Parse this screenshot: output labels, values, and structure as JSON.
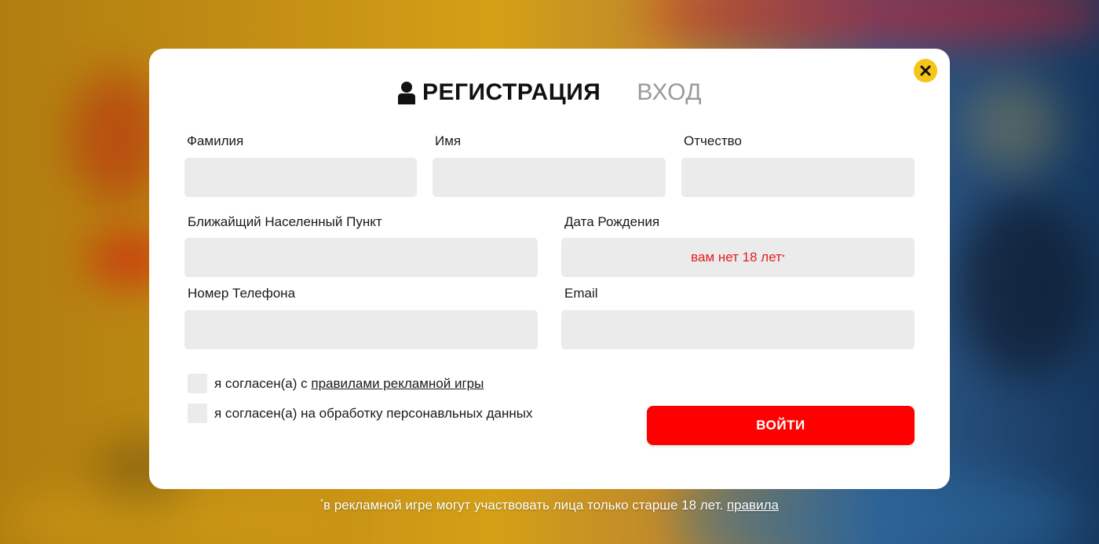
{
  "modal": {
    "tabs": {
      "register_label": "РЕГИСТРАЦИЯ",
      "login_label": "ВХОД"
    },
    "fields": {
      "surname_label": "Фамилия",
      "name_label": "Имя",
      "patronymic_label": "Отчество",
      "city_label": "Ближайщий Населенный Пункт",
      "birthdate_label": "Дата Рождения",
      "birthdate_error": "вам нет 18 лет",
      "birthdate_error_mark": "*",
      "phone_label": "Номер Телефона",
      "email_label": "Email"
    },
    "consents": {
      "rules_prefix": "я согласен(а) с",
      "rules_link": "правилами рекламной игры",
      "personal_data": "я согласен(а) на обработку персонавльных данных"
    },
    "submit_label": "ВОЙТИ"
  },
  "footnote": {
    "mark": "*",
    "text": "в рекламной игре могут участвовать лица только старше 18 лет.",
    "link": "правила"
  },
  "colors": {
    "accent_red": "#ff0000",
    "error_red": "#e31e24",
    "close_yellow": "#f5c518",
    "input_bg": "#ebebeb"
  },
  "icons": {
    "close": "close-icon",
    "user": "user-icon"
  }
}
